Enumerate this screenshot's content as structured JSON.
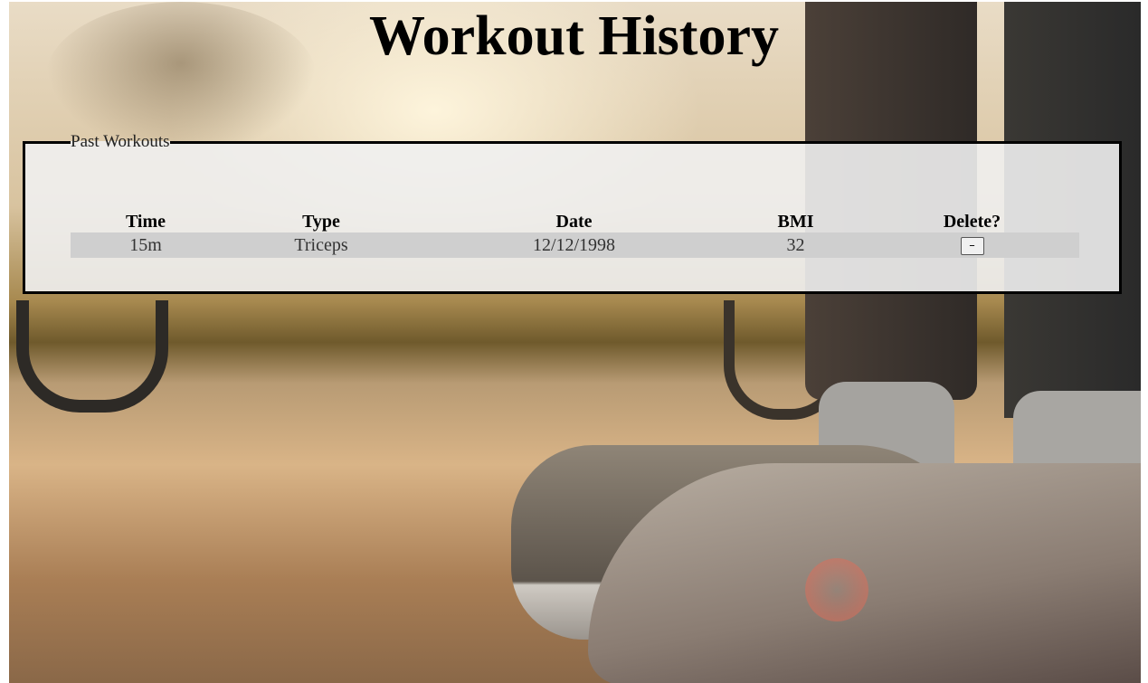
{
  "page": {
    "title": "Workout History"
  },
  "panel": {
    "legend": "Past Workouts"
  },
  "table": {
    "headers": {
      "time": "Time",
      "type": "Type",
      "date": "Date",
      "bmi": "BMI",
      "delete": "Delete?"
    },
    "rows": [
      {
        "time": "15m",
        "type": "Triceps",
        "date": "12/12/1998",
        "bmi": "32",
        "delete_label": "–"
      }
    ]
  }
}
